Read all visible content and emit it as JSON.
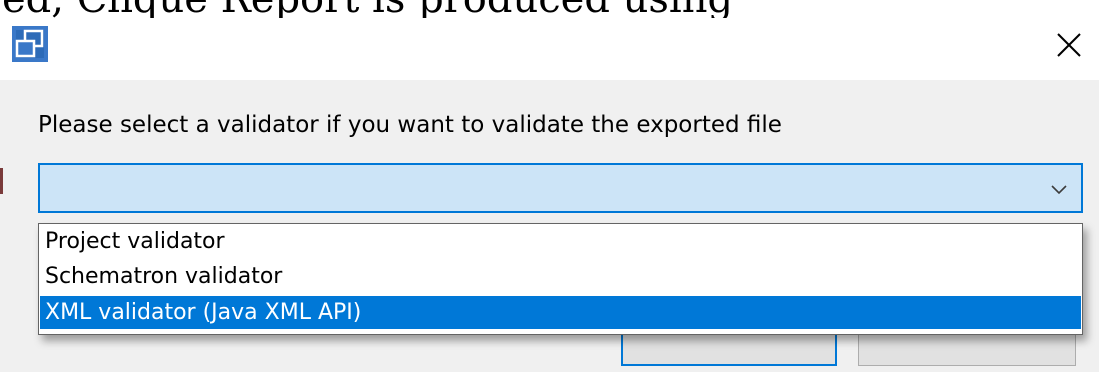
{
  "window": {
    "app_icon": "window-restore-icon",
    "close_icon": "close-icon",
    "close_glyph": "✕"
  },
  "cutoff_text": "ed, Cliqué Report is produced using",
  "dialog": {
    "prompt": "Please select a validator if you want to validate the exported file",
    "combo": {
      "value": "",
      "chevron_icon": "chevron-down-icon"
    },
    "dropdown_options": [
      {
        "label": "Project validator",
        "selected": false
      },
      {
        "label": "Schematron validator",
        "selected": false
      },
      {
        "label": "XML validator (Java XML API)",
        "selected": true
      }
    ]
  },
  "colors": {
    "accent": "#0078d7",
    "combo_bg": "#cce4f7",
    "dialog_bg": "#f0f0f0"
  }
}
